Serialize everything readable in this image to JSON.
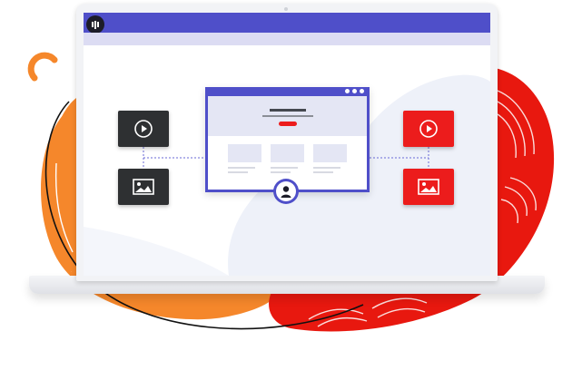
{
  "illustration": {
    "subject": "laptop-showing-webpage-with-media-tiles",
    "colors": {
      "window_bar": "#4f4fc9",
      "window_subbar": "#dcdcf3",
      "orange_blob": "#f5872b",
      "red_blob": "#e8180f",
      "dark_tile": "#2e3032",
      "red_tile": "#ec1c1c",
      "accent_button": "#ec1c1c"
    },
    "icons": {
      "logo": "bars-logo-icon",
      "video": "play-icon",
      "image": "image-icon",
      "user": "user-avatar-icon"
    }
  }
}
